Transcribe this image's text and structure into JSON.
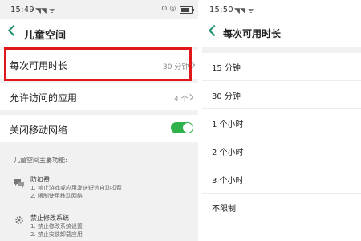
{
  "left": {
    "status": {
      "time": "15:49",
      "signal": "◥◥ ᯤ",
      "icons": "⊙ ◎"
    },
    "title": "儿童空间",
    "rows": {
      "duration": {
        "label": "每次可用时长",
        "value": "30 分钟"
      },
      "apps": {
        "label": "允许访问的应用",
        "value": "4 个"
      },
      "network": {
        "label": "关闭移动网络",
        "on": true
      }
    },
    "features": {
      "heading": "儿童空间主要功能:",
      "items": [
        {
          "title": "防扣费",
          "lines": [
            "1. 禁止游戏或应用发送短信自动扣费",
            "2. 限制使用移动网络"
          ]
        },
        {
          "title": "禁止修改系统",
          "lines": [
            "1. 禁止修改系统设置",
            "2. 禁止安装卸载应用"
          ]
        }
      ]
    }
  },
  "right": {
    "status": {
      "time": "15:50",
      "signal": "◥◥ ᯤ"
    },
    "title": "每次可用时长",
    "options": [
      "15 分钟",
      "30 分钟",
      "1 个小时",
      "2 个小时",
      "3 个小时",
      "不限制"
    ]
  },
  "colors": {
    "accent": "#1c8f6f",
    "toggle_on": "#2fb24c",
    "highlight": "#e0181c"
  }
}
